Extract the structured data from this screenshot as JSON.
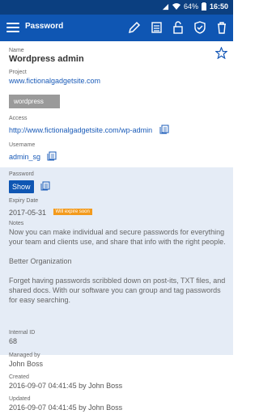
{
  "status_bar": {
    "battery": "64%",
    "time": "16:50"
  },
  "app_bar": {
    "title": "Password",
    "actions": [
      "edit-icon",
      "list-icon",
      "lock-icon",
      "shield-icon",
      "trash-icon"
    ]
  },
  "name": {
    "label": "Name",
    "value": "Wordpress admin"
  },
  "project": {
    "label": "Project",
    "value": "www.fictionalgadgetsite.com"
  },
  "tag": "wordpress",
  "access": {
    "label": "Access",
    "value": "http://www.fictionalgadgetsite.com/wp-admin"
  },
  "username": {
    "label": "Username",
    "value": "admin_sg"
  },
  "password": {
    "label": "Password",
    "show_label": "Show"
  },
  "expiry": {
    "label": "Expiry Date",
    "value": "2017-05-31",
    "warning": "Will expire soon"
  },
  "notes": {
    "label": "Notes",
    "p1": "Now you can make individual and secure passwords for everything your team and clients use, and share that info with the right people.",
    "p2": "Better Organization",
    "p3": "Forget having passwords scribbled down on post-its, TXT files, and shared docs. With our software you can group and tag passwords for easy searching."
  },
  "internal_id": {
    "label": "Internal ID",
    "value": "68"
  },
  "managed_by": {
    "label": "Managed by",
    "value": "John Boss"
  },
  "created": {
    "label": "Created",
    "value": "2016-09-07 04:41:45 by John Boss"
  },
  "updated": {
    "label": "Updated",
    "value": "2016-09-07 04:41:45 by John Boss"
  },
  "colors": {
    "status_bar": "#0b3f80",
    "app_bar": "#0f56b3",
    "link": "#1a5bb8",
    "warning": "#f39a1c",
    "highlight": "#e5ecf6"
  }
}
